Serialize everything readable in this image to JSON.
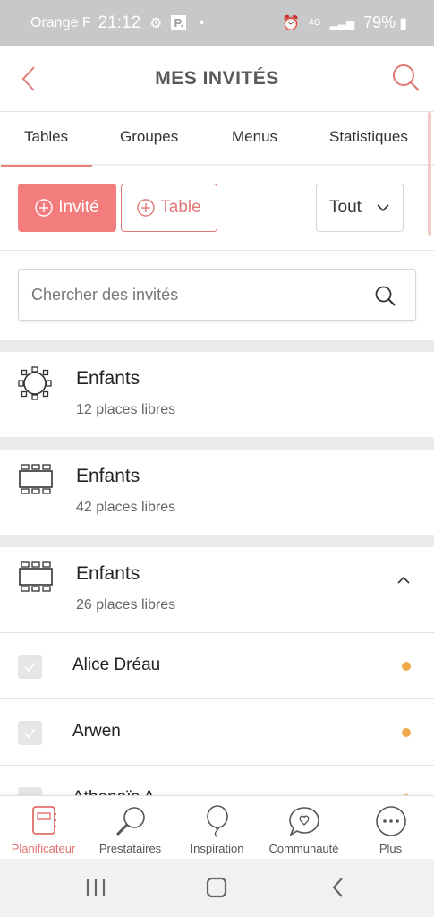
{
  "status_bar": {
    "carrier": "Orange F",
    "time": "21:12",
    "p_badge": "P.",
    "network": "4G",
    "battery": "79%"
  },
  "header": {
    "title": "MES INVITÉS"
  },
  "tabs": [
    {
      "label": "Tables",
      "active": true
    },
    {
      "label": "Groupes",
      "active": false
    },
    {
      "label": "Menus",
      "active": false
    },
    {
      "label": "Statistiques",
      "active": false
    }
  ],
  "actions": {
    "invite_label": "Invité",
    "table_label": "Table",
    "filter_value": "Tout"
  },
  "search": {
    "placeholder": "Chercher des invités"
  },
  "tables": [
    {
      "name": "Enfants",
      "seats": "12 places libres",
      "shape": "round-table-icon",
      "expanded": false
    },
    {
      "name": "Enfants",
      "seats": "42 places libres",
      "shape": "rectangular-table-icon",
      "expanded": false
    },
    {
      "name": "Enfants",
      "seats": "26 places libres",
      "shape": "rectangular-table-icon",
      "expanded": true
    }
  ],
  "guests": [
    {
      "name": "Alice Dréau"
    },
    {
      "name": "Arwen"
    },
    {
      "name": "Athenaïs A"
    }
  ],
  "bottom_nav": [
    {
      "label": "Planificateur",
      "icon": "notebook-icon",
      "active": true
    },
    {
      "label": "Prestataires",
      "icon": "magnifier-icon",
      "active": false
    },
    {
      "label": "Inspiration",
      "icon": "balloon-icon",
      "active": false
    },
    {
      "label": "Communauté",
      "icon": "chat-heart-icon",
      "active": false
    },
    {
      "label": "Plus",
      "icon": "more-dots-icon",
      "active": false
    }
  ],
  "colors": {
    "accent": "#f37c7c",
    "accent_dark": "#e07876",
    "status_dot": "#f2a94a"
  }
}
